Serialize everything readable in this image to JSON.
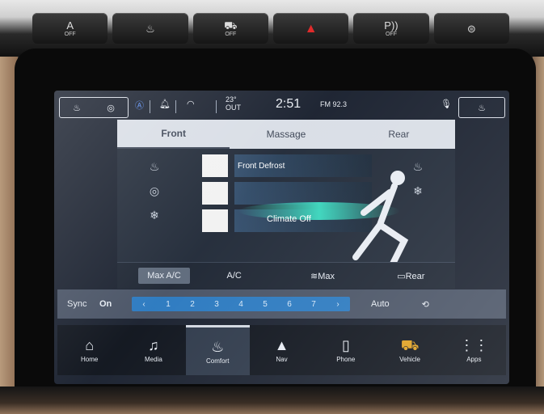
{
  "hardware": [
    {
      "icon": "auto-stop-icon",
      "glyph": "A",
      "label": "OFF"
    },
    {
      "icon": "heated-wheel-icon",
      "glyph": "♨",
      "label": ""
    },
    {
      "icon": "traction-off-icon",
      "glyph": "⛟",
      "label": "OFF"
    },
    {
      "icon": "hazard-icon",
      "glyph": "▲",
      "label": ""
    },
    {
      "icon": "park-sense-icon",
      "glyph": "P))",
      "label": "OFF"
    },
    {
      "icon": "lane-keep-icon",
      "glyph": "⊜",
      "label": ""
    }
  ],
  "status": {
    "temp_value": "23°",
    "temp_label": "OUT",
    "clock": "2:51",
    "radio_band": "FM",
    "radio_freq": "92.3"
  },
  "tabs": [
    {
      "label": "Front",
      "active": true
    },
    {
      "label": "Massage",
      "active": false
    },
    {
      "label": "Rear",
      "active": false
    }
  ],
  "climate": {
    "front_defrost": "Front Defrost",
    "climate_off": "Climate Off"
  },
  "ac_row": {
    "max_ac": "Max A/C",
    "ac": "A/C",
    "max_defrost": "Max",
    "rear_defrost": "Rear"
  },
  "fan": {
    "sync": "Sync",
    "on": "On",
    "speeds": [
      "‹",
      "1",
      "2",
      "3",
      "4",
      "5",
      "6",
      "7",
      "›"
    ],
    "auto": "Auto"
  },
  "nav": [
    {
      "label": "Home",
      "glyph": "⌂",
      "active": false
    },
    {
      "label": "Media",
      "glyph": "♫",
      "active": false
    },
    {
      "label": "Comfort",
      "glyph": "♨",
      "active": true
    },
    {
      "label": "Nav",
      "glyph": "▲",
      "active": false
    },
    {
      "label": "Phone",
      "glyph": "▯",
      "active": false
    },
    {
      "label": "Vehicle",
      "glyph": "⛟",
      "active": false
    },
    {
      "label": "Apps",
      "glyph": "⋮⋮",
      "active": false
    }
  ],
  "colors": {
    "screen_bg": "#1b2230",
    "tab_bg": "#d9dee6",
    "fan_active": "#2c7ac0",
    "hazard": "#e02b2b"
  }
}
